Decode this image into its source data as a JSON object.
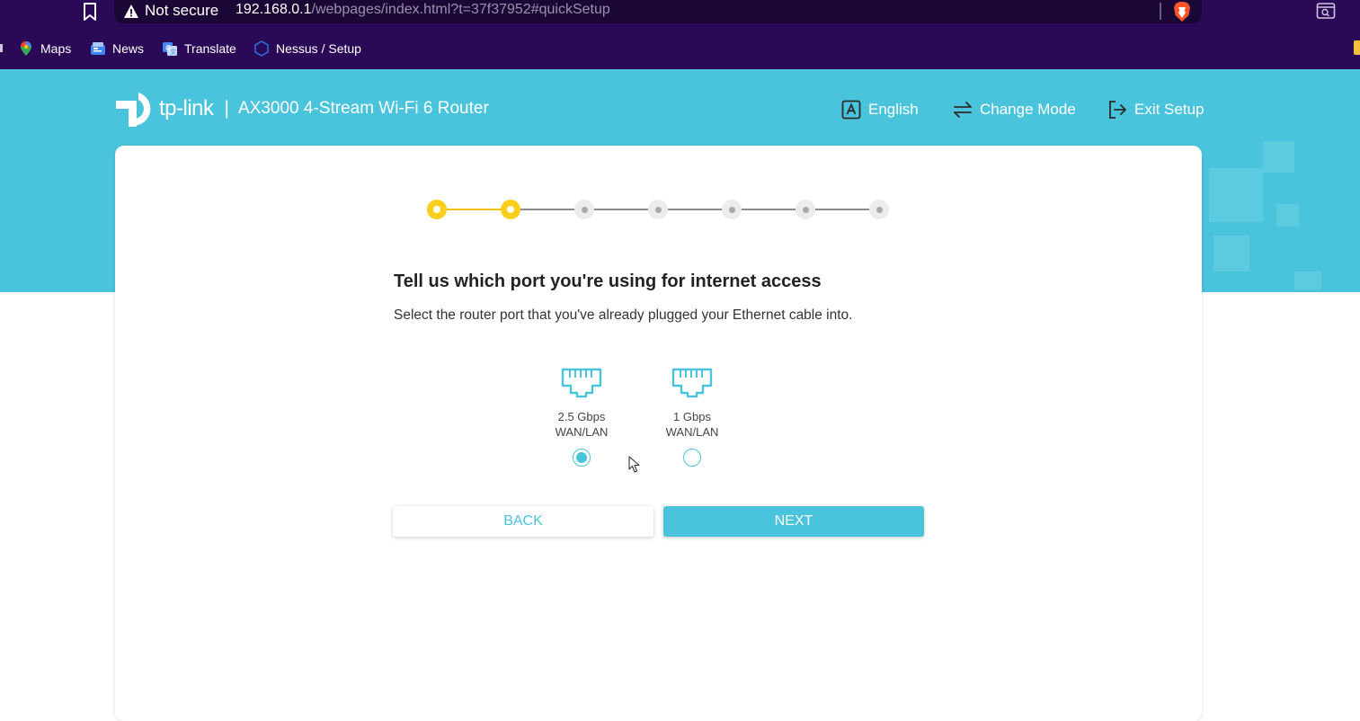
{
  "browser": {
    "security_label": "Not secure",
    "url_host": "192.168.0.1",
    "url_path": "/webpages/index.html?t=37f37952#quickSetup",
    "bookmarks": [
      {
        "label": "Maps",
        "icon": "maps-pin-icon"
      },
      {
        "label": "News",
        "icon": "news-icon"
      },
      {
        "label": "Translate",
        "icon": "translate-icon"
      },
      {
        "label": "Nessus / Setup",
        "icon": "nessus-hexagon-icon"
      }
    ]
  },
  "header": {
    "logo_text": "tp-link",
    "divider": "|",
    "product": "AX3000 4-Stream Wi-Fi 6 Router",
    "language": "English",
    "change_mode": "Change Mode",
    "exit_setup": "Exit Setup"
  },
  "setup": {
    "steps_total": 7,
    "steps_completed": 2,
    "title": "Tell us which port you're using for internet access",
    "description": "Select the router port that you've already plugged your Ethernet cable into.",
    "ports": [
      {
        "speed": "2.5 Gbps",
        "type": "WAN/LAN",
        "selected": true
      },
      {
        "speed": "1 Gbps",
        "type": "WAN/LAN",
        "selected": false
      }
    ],
    "back_label": "BACK",
    "next_label": "NEXT"
  },
  "colors": {
    "brand": "#4ac4dc",
    "step_done": "#f9cf1c",
    "browser_bg": "#2a0a56"
  }
}
